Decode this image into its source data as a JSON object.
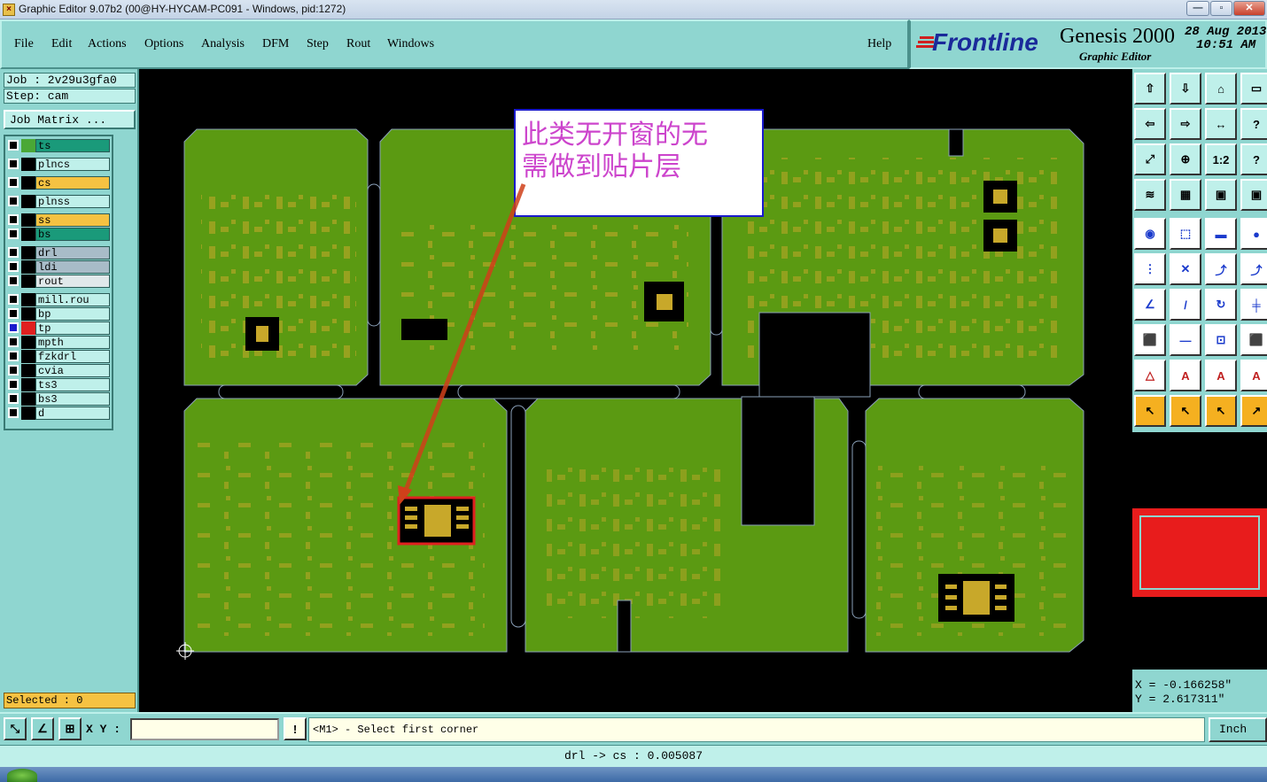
{
  "window": {
    "title": "Graphic Editor 9.07b2 (00@HY-HYCAM-PC091 - Windows, pid:1272)"
  },
  "menu": {
    "items": [
      "File",
      "Edit",
      "Actions",
      "Options",
      "Analysis",
      "DFM",
      "Step",
      "Rout",
      "Windows"
    ],
    "help": "Help"
  },
  "brand": {
    "logo": "Frontline",
    "product": "Genesis 2000",
    "subtitle": "Graphic Editor",
    "date": "28 Aug 2013",
    "time": "10:51 AM"
  },
  "job": {
    "job_label": "Job : 2v29u3gfa0",
    "step_label": "Step: cam",
    "matrix_button": "Job Matrix ..."
  },
  "layers": [
    {
      "name": "ts",
      "color": "#1a9a7a",
      "swatch": "#4aa836"
    },
    {
      "name": "plncs",
      "color": "#bff0ea",
      "swatch": "#000000"
    },
    {
      "name": "cs",
      "color": "#f5c242",
      "swatch": "#000000"
    },
    {
      "name": "plnss",
      "color": "#bff0ea",
      "swatch": "#000000"
    },
    {
      "name": "ss",
      "color": "#f5c242",
      "swatch": "#000000"
    },
    {
      "name": "bs",
      "color": "#1a9a7a",
      "swatch": "#000000"
    },
    {
      "name": "drl",
      "color": "#a8bcc8",
      "swatch": "#000000"
    },
    {
      "name": "ldi",
      "color": "#a8bcc8",
      "swatch": "#000000"
    },
    {
      "name": "rout",
      "color": "#e0e8ea",
      "swatch": "#000000"
    },
    {
      "name": "mill.rou",
      "color": "#bff0ea",
      "swatch": "#000000"
    },
    {
      "name": "bp",
      "color": "#bff0ea",
      "swatch": "#000000"
    },
    {
      "name": "tp",
      "color": "#bff0ea",
      "swatch": "#e02020"
    },
    {
      "name": "mpth",
      "color": "#bff0ea",
      "swatch": "#000000"
    },
    {
      "name": "fzkdrl",
      "color": "#bff0ea",
      "swatch": "#000000"
    },
    {
      "name": "cvia",
      "color": "#bff0ea",
      "swatch": "#000000"
    },
    {
      "name": "ts3",
      "color": "#bff0ea",
      "swatch": "#000000"
    },
    {
      "name": "bs3",
      "color": "#bff0ea",
      "swatch": "#000000"
    },
    {
      "name": "d",
      "color": "#bff0ea",
      "swatch": "#000000"
    }
  ],
  "selected": "Selected : 0",
  "annotation": {
    "line1": "此类无开窗的无",
    "line2": "需做到贴片层"
  },
  "coords": {
    "x": "X = -0.166258\"",
    "y": "Y = 2.617311\""
  },
  "prompt": {
    "xy_label": "X Y :",
    "xy_value": "",
    "message": "<M1> - Select first corner",
    "units": "Inch"
  },
  "status": "drl -> cs : 0.005087",
  "colors": {
    "board": "#5b9a12",
    "pad": "#c8a82a",
    "panel_bg": "#8fd6d0",
    "routing": "#000000",
    "highlight": "#e02020"
  },
  "toolbar_icons": [
    "zoom-home-icon",
    "zoom-in-icon",
    "zoom-out-icon",
    "fit-icon",
    "pan-left-icon",
    "pan-right-icon",
    "measure-icon",
    "help-icon",
    "rotate-icon",
    "move-icon",
    "scale-icon",
    "grid-icon"
  ]
}
